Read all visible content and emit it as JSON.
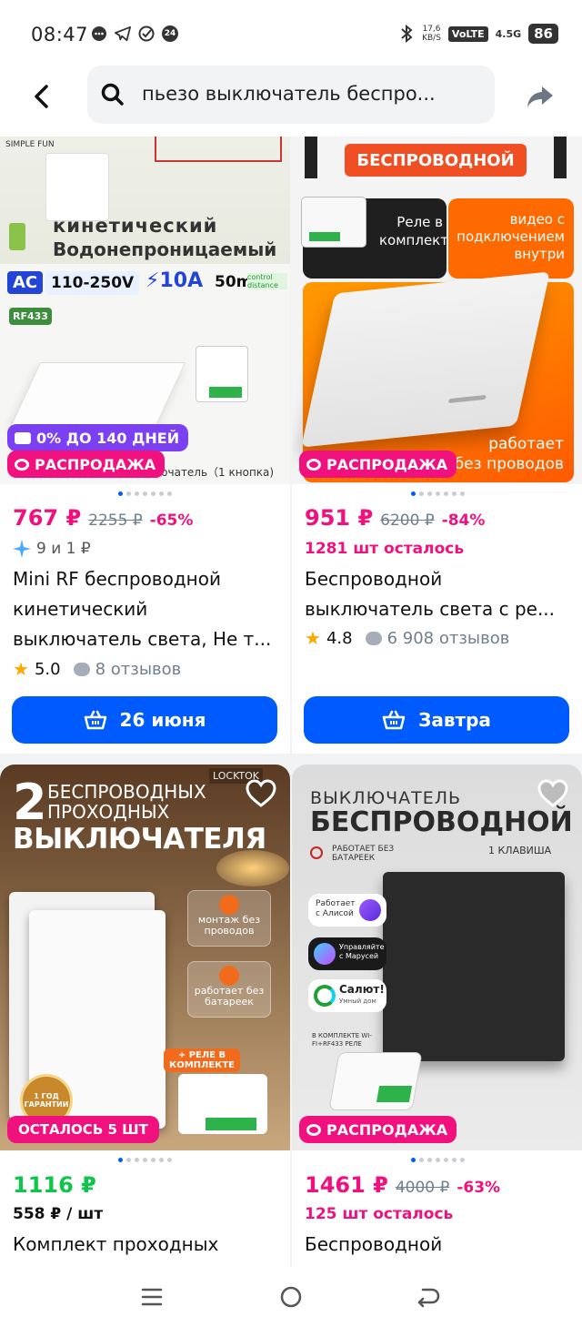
{
  "status": {
    "time": "08:47",
    "icons_left": [
      "chat-icon",
      "telegram-icon",
      "check-circle-icon",
      "badge-24-icon"
    ],
    "badge": "24",
    "speed_value": "17,6",
    "speed_unit": "KB/S",
    "volte": "VoLTE",
    "network": "4.5G",
    "battery": "86"
  },
  "search": {
    "query": "пьезо выключатель беспро..."
  },
  "products": [
    {
      "image_texts": {
        "brand": "SIMPLE FUN",
        "line1": "кинетический",
        "line2": "Водонепроницаемый",
        "ac": "AC",
        "voltage": "110-250V",
        "current": "10A",
        "distance": "50m",
        "distance_note": "control distance",
        "rf": "RF433",
        "caption": "ыключатель（1 кнопка)"
      },
      "installment_tag": "0% ДО 140 ДНЕЙ",
      "sale_tag": "РАСПРОДАЖА",
      "price": "767 ₽",
      "old_price": "2255 ₽",
      "discount": "-65%",
      "installment": "9 и 1 ₽",
      "title": "Mini RF беспроводной кинетический выключатель света, Не т...",
      "rating": "5.0",
      "reviews": "8 отзывов",
      "delivery": "26 июня"
    },
    {
      "image_texts": {
        "header": "БЕСПРОВОДНОЙ",
        "relay": "Реле в комплекте",
        "video": "видео с подключением внутри",
        "works1": "работает",
        "works2": "без проводов"
      },
      "sale_tag": "РАСПРОДАЖА",
      "price": "951 ₽",
      "old_price": "6200 ₽",
      "discount": "-84%",
      "stock": "1281 шт осталось",
      "title": "Беспроводной выключатель света с ре...",
      "rating": "4.8",
      "reviews": "6 908 отзывов",
      "delivery": "Завтра"
    },
    {
      "image_texts": {
        "brand": "LOCKTOK",
        "big2": "2",
        "line1": "БЕСПРОВОДНЫХ",
        "line2": "ПРОХОДНЫХ",
        "line3": "ВЫКЛЮЧАТЕЛЯ",
        "feat1": "монтаж без проводов",
        "feat2": "работает без батареек",
        "relay": "+ РЕЛЕ В КОМПЛЕКТЕ",
        "warranty": "1 ГОД ГАРАНТИИ"
      },
      "left_tag": "ОСТАЛОСЬ 5 ШТ",
      "price": "1116 ₽",
      "unit_price": "558 ₽ / шт",
      "title": "Комплект проходных"
    },
    {
      "image_texts": {
        "line1": "ВЫКЛЮЧАТЕЛЬ",
        "line2": "БЕСПРОВОДНОЙ",
        "keys": "1 КЛАВИША",
        "nobat": "РАБОТАЕТ БЕЗ БАТАРЕЕК",
        "alice": "Работает с Алисой",
        "marusya": "Управляйте с Марусей",
        "salut": "Салют!",
        "salut_sub": "Умный дом",
        "kit": "В КОМПЛЕКТЕ WI-FI+RF433 РЕЛЕ"
      },
      "sale_tag": "РАСПРОДАЖА",
      "price": "1461 ₽",
      "old_price": "4000 ₽",
      "discount": "-63%",
      "stock": "125 шт осталось",
      "title": "Беспроводной"
    }
  ],
  "colors": {
    "accent_blue": "#005bff",
    "sale_pink": "#f1117e",
    "price_green": "#10c44c",
    "installment_purple": "#7b40f2",
    "star": "#ffa800"
  }
}
